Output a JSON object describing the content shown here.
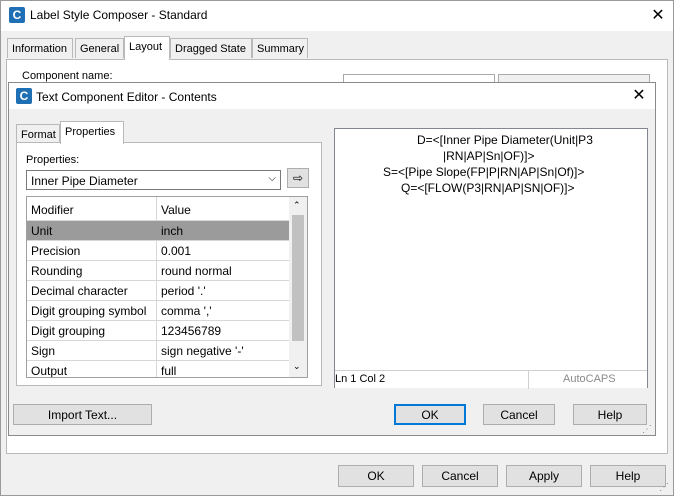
{
  "outer": {
    "title": "Label Style Composer - Standard",
    "tabs": [
      "Information",
      "General",
      "Layout",
      "Dragged State",
      "Summary"
    ],
    "active_tab": "Layout",
    "component_name_label": "Component name:",
    "buttons": {
      "ok": "OK",
      "cancel": "Cancel",
      "apply": "Apply",
      "help": "Help"
    }
  },
  "editor_dialog": {
    "title": "Text Component Editor - Contents",
    "tabs": [
      "Format",
      "Properties"
    ],
    "active_tab": "Properties",
    "properties_label": "Properties:",
    "properties_value": "Inner Pipe Diameter",
    "grid": {
      "headers": [
        "Modifier",
        "Value"
      ],
      "rows": [
        {
          "modifier": "Unit",
          "value": "inch"
        },
        {
          "modifier": "Precision",
          "value": "0.001"
        },
        {
          "modifier": "Rounding",
          "value": "round normal"
        },
        {
          "modifier": "Decimal character",
          "value": "period '.'"
        },
        {
          "modifier": "Digit grouping symbol",
          "value": "comma ','"
        },
        {
          "modifier": "Digit grouping",
          "value": "123456789"
        },
        {
          "modifier": "Sign",
          "value": "sign negative '-'"
        },
        {
          "modifier": "Output",
          "value": "full"
        }
      ]
    },
    "editor_lines": [
      "D=<[Inner Pipe Diameter(Unit|P3",
      "|RN|AP|Sn|OF)]>",
      "S=<[Pipe Slope(FP|P|RN|AP|Sn|Of)]>",
      "Q=<[FLOW(P3|RN|AP|SN|OF)]>"
    ],
    "status_position": "Ln 1 Col 2",
    "status_caps": "AutoCAPS",
    "buttons": {
      "import": "Import Text...",
      "ok": "OK",
      "cancel": "Cancel",
      "help": "Help"
    }
  },
  "colors": {
    "accent": "#0078d7",
    "selected_row": "#9b9b9b",
    "app_icon": "#1f6fb4"
  }
}
